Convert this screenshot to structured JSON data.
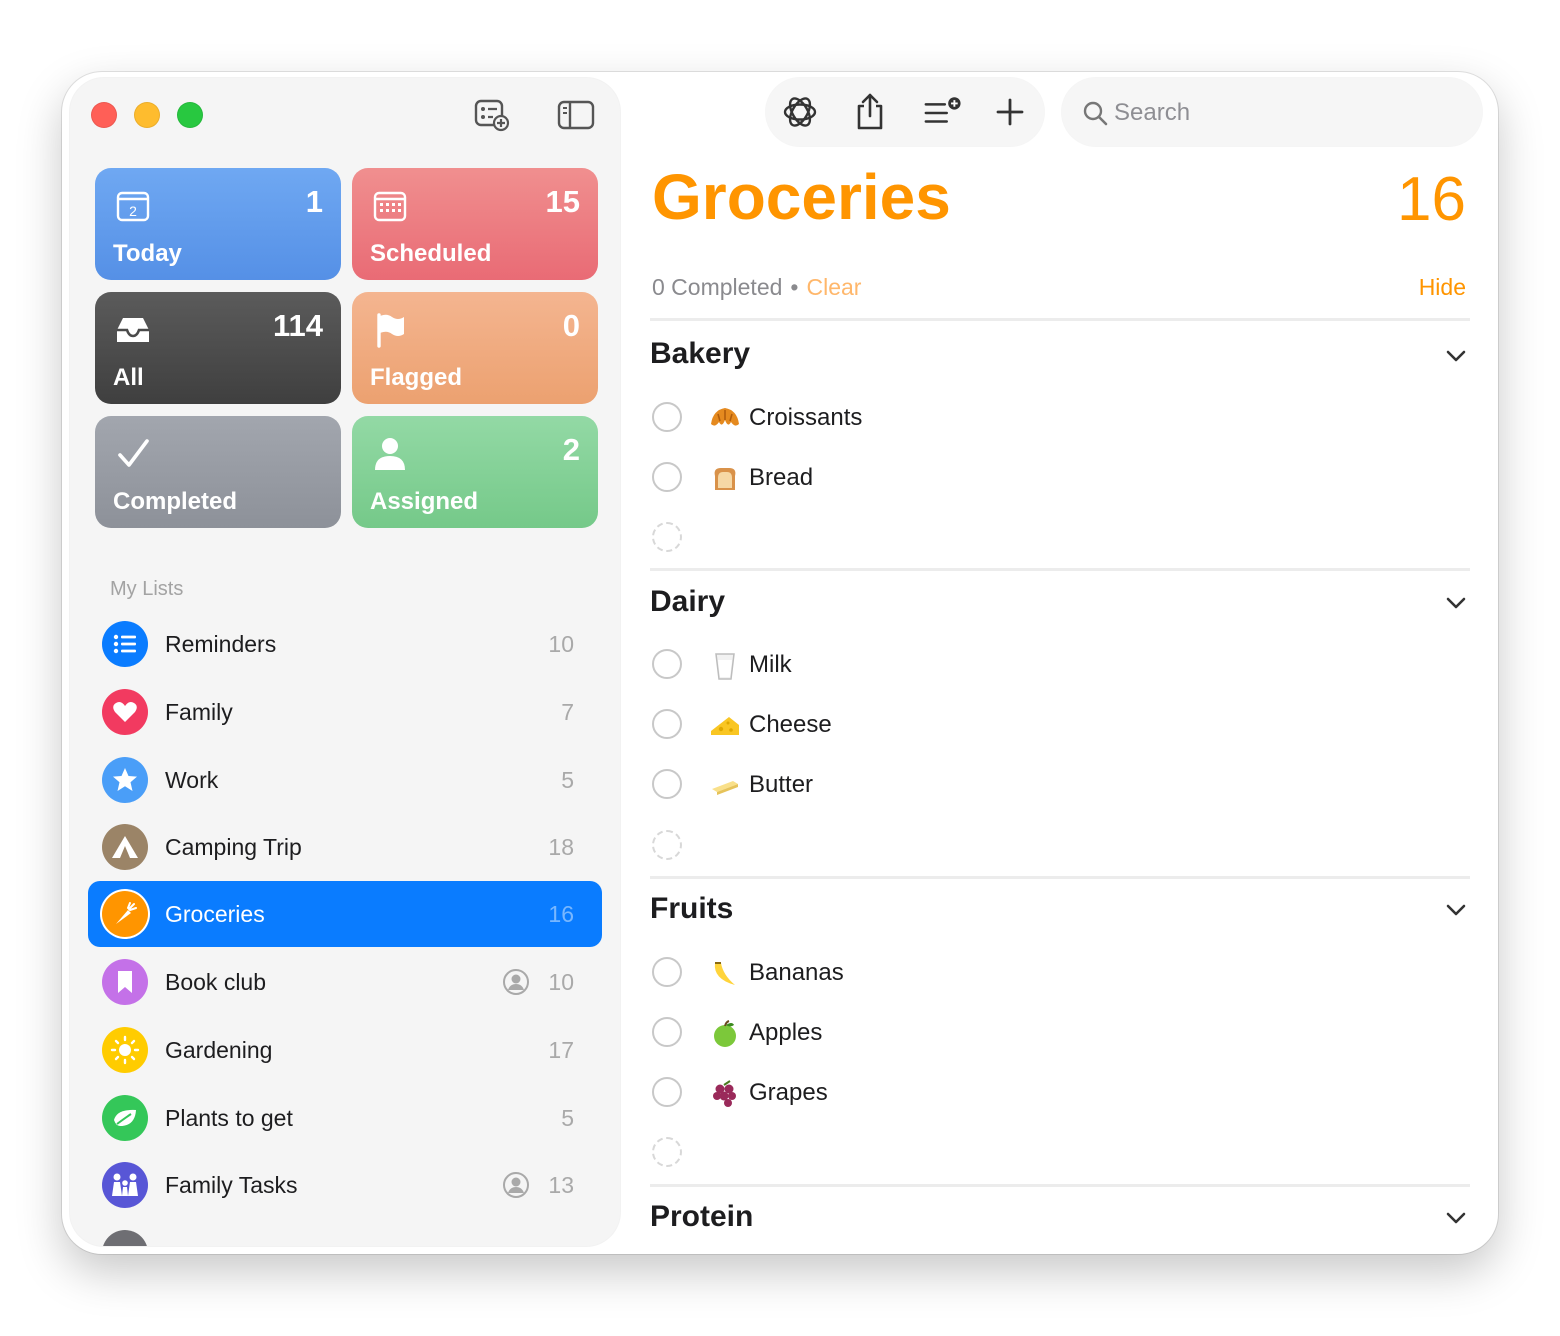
{
  "sidebar": {
    "tiles": [
      {
        "label": "Today",
        "count": "1",
        "icon": "calendar-today-icon",
        "day": "2"
      },
      {
        "label": "Scheduled",
        "count": "15",
        "icon": "calendar-grid-icon"
      },
      {
        "label": "All",
        "count": "114",
        "icon": "tray-icon"
      },
      {
        "label": "Flagged",
        "count": "0",
        "icon": "flag-icon"
      },
      {
        "label": "Completed",
        "count": "",
        "icon": "checkmark-icon"
      },
      {
        "label": "Assigned",
        "count": "2",
        "icon": "person-icon"
      }
    ],
    "my_lists_header": "My Lists",
    "lists": [
      {
        "name": "Reminders",
        "count": "10",
        "icon": "list-bullet-icon",
        "color": "#0a7cff"
      },
      {
        "name": "Family",
        "count": "7",
        "icon": "heart-icon",
        "color": "#f23a60"
      },
      {
        "name": "Work",
        "count": "5",
        "icon": "star-icon",
        "color": "#4a9ef8"
      },
      {
        "name": "Camping Trip",
        "count": "18",
        "icon": "tent-icon",
        "color": "#9b8467"
      },
      {
        "name": "Groceries",
        "count": "16",
        "icon": "carrot-icon",
        "color": "#ff9500",
        "selected": true
      },
      {
        "name": "Book club",
        "count": "10",
        "icon": "bookmark-icon",
        "color": "#c471e8",
        "shared": true
      },
      {
        "name": "Gardening",
        "count": "17",
        "icon": "sun-icon",
        "color": "#ffcc00"
      },
      {
        "name": "Plants to get",
        "count": "5",
        "icon": "leaf-icon",
        "color": "#34c759"
      },
      {
        "name": "Family Tasks",
        "count": "13",
        "icon": "family-icon",
        "color": "#5856d6",
        "shared": true
      }
    ]
  },
  "toolbar": {
    "icons": [
      "openai-icon",
      "share-icon",
      "add-section-icon",
      "plus-icon"
    ],
    "search_placeholder": "Search"
  },
  "main": {
    "title": "Groceries",
    "count": "16",
    "completed_text": "0 Completed",
    "separator": "•",
    "clear_label": "Clear",
    "hide_label": "Hide",
    "accent": "#ff9500",
    "sections": [
      {
        "title": "Bakery",
        "items": [
          {
            "name": "Croissants",
            "emoji": "🥐"
          },
          {
            "name": "Bread",
            "emoji": "🍞"
          }
        ]
      },
      {
        "title": "Dairy",
        "items": [
          {
            "name": "Milk",
            "emoji": "🥛"
          },
          {
            "name": "Cheese",
            "emoji": "🧀"
          },
          {
            "name": "Butter",
            "emoji": "🧈"
          }
        ]
      },
      {
        "title": "Fruits",
        "items": [
          {
            "name": "Bananas",
            "emoji": "🍌"
          },
          {
            "name": "Apples",
            "emoji": "🍏"
          },
          {
            "name": "Grapes",
            "emoji": "🍇"
          }
        ]
      },
      {
        "title": "Protein",
        "items": []
      }
    ]
  }
}
